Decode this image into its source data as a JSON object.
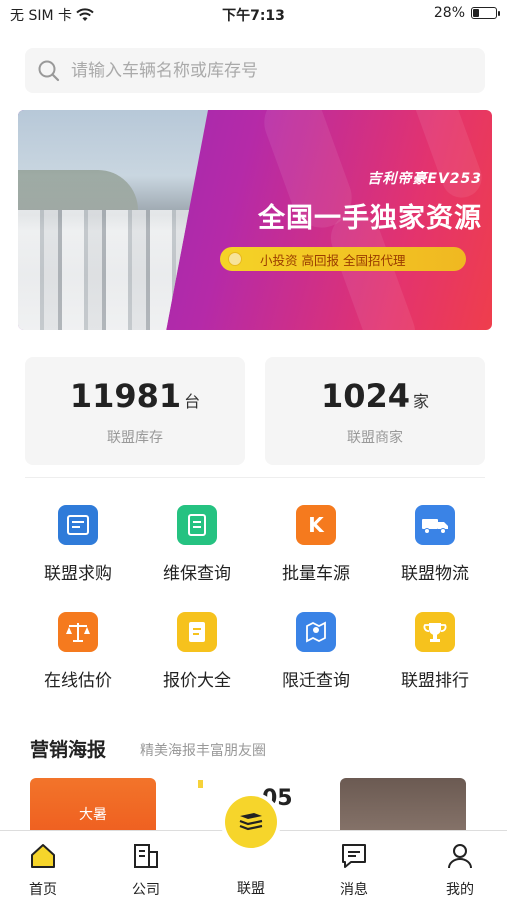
{
  "status_bar": {
    "carrier": "无 SIM 卡",
    "time": "下午7:13",
    "battery_text": "28%",
    "battery_level": 0.28
  },
  "search": {
    "placeholder": "请输入车辆名称或库存号"
  },
  "banner": {
    "subtitle": "吉利帝豪EV253",
    "title": "全国一手独家资源",
    "pill_text": "小投资 高回报 全国招代理"
  },
  "stats": [
    {
      "value": "11981",
      "unit": "台",
      "label": "联盟库存"
    },
    {
      "value": "1024",
      "unit": "家",
      "label": "联盟商家"
    }
  ],
  "menu": [
    {
      "label": "联盟求购",
      "icon": "purchase-doc-icon",
      "color": "#2f7bd9"
    },
    {
      "label": "维保查询",
      "icon": "maintenance-doc-icon",
      "color": "#25c281"
    },
    {
      "label": "批量车源",
      "icon": "batch-source-icon",
      "color": "#f57a1e",
      "glyph": "K"
    },
    {
      "label": "联盟物流",
      "icon": "truck-icon",
      "color": "#3a83e6"
    },
    {
      "label": "在线估价",
      "icon": "scale-icon",
      "color": "#f57a1e"
    },
    {
      "label": "报价大全",
      "icon": "quote-book-icon",
      "color": "#f6c21d"
    },
    {
      "label": "限迁查询",
      "icon": "map-pin-icon",
      "color": "#3a83e6"
    },
    {
      "label": "联盟排行",
      "icon": "trophy-icon",
      "color": "#f6c21d"
    }
  ],
  "marketing": {
    "title": "营销海报",
    "subtitle": "精美海报丰富朋友圈",
    "posters": [
      {
        "text": "大暑"
      },
      {
        "date": "05"
      },
      {
        "text": ""
      }
    ]
  },
  "tabbar": {
    "items": [
      {
        "label": "首页",
        "icon": "home-icon",
        "active": true
      },
      {
        "label": "公司",
        "icon": "building-icon"
      },
      {
        "label": "联盟",
        "icon": "alliance-icon",
        "center": true
      },
      {
        "label": "消息",
        "icon": "message-icon"
      },
      {
        "label": "我的",
        "icon": "user-icon"
      }
    ]
  },
  "colors": {
    "accent_yellow": "#f6d52b",
    "banner_purple": "#8a2cb8",
    "banner_red": "#ef3e4c"
  }
}
